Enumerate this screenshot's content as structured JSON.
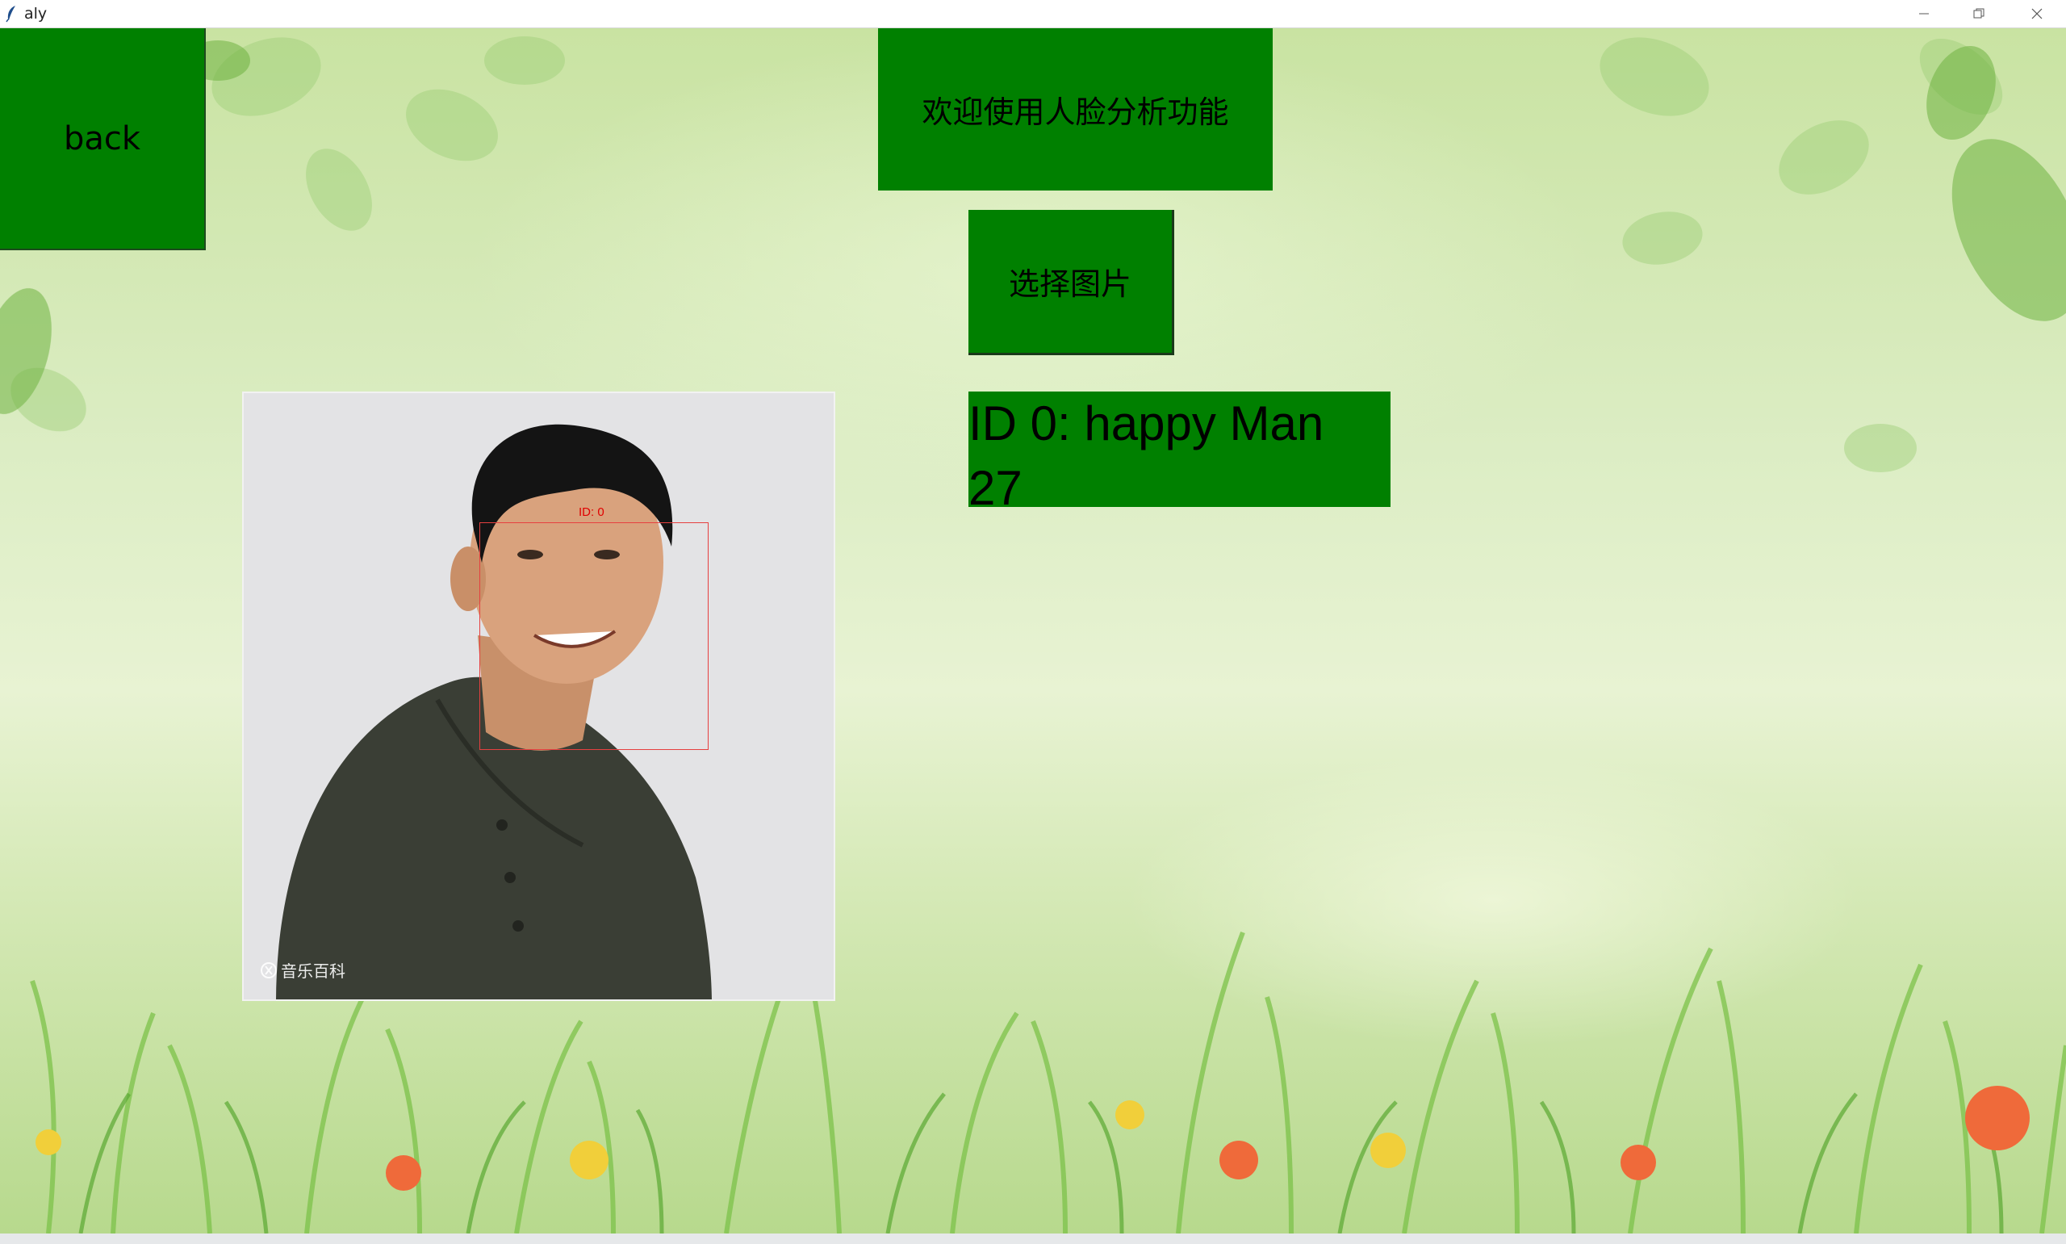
{
  "window": {
    "title": "aly"
  },
  "buttons": {
    "back": "back",
    "select_image": "选择图片"
  },
  "labels": {
    "welcome": "欢迎使用人脸分析功能",
    "result": "ID 0: happy Man 27"
  },
  "photo": {
    "face_box_label": "ID: 0",
    "watermark": "音乐百科"
  },
  "colors": {
    "button_green": "#008000",
    "face_box": "#e64040"
  },
  "icons": {
    "app": "feather-icon",
    "minimize": "minimize-icon",
    "maximize": "restore-icon",
    "close": "close-icon"
  }
}
